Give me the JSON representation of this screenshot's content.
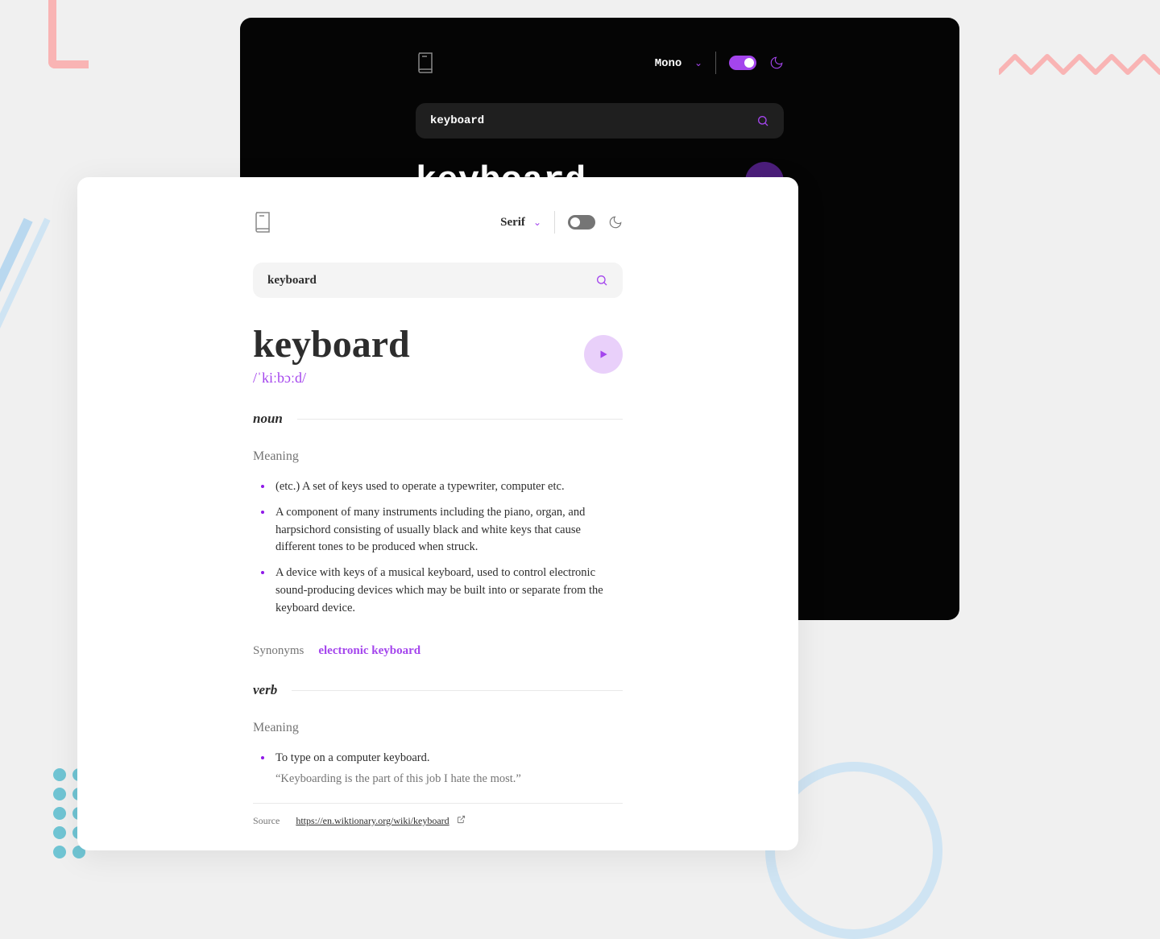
{
  "dark": {
    "font_label": "Mono",
    "search_value": "keyboard",
    "word": "keyboard"
  },
  "light": {
    "font_label": "Serif",
    "search_value": "keyboard",
    "word": "keyboard",
    "phonetic": "/ˈkiːbɔːd/",
    "noun": {
      "pos": "noun",
      "meaning_label": "Meaning",
      "defs": [
        "(etc.) A set of keys used to operate a typewriter, computer etc.",
        "A component of many instruments including the piano, organ, and harpsichord consisting of usually black and white keys that cause different tones to be produced when struck.",
        "A device with keys of a musical keyboard, used to control electronic sound-producing devices which may be built into or separate from the keyboard device."
      ],
      "synonyms_label": "Synonyms",
      "synonyms": "electronic keyboard"
    },
    "verb": {
      "pos": "verb",
      "meaning_label": "Meaning",
      "def": "To type on a computer keyboard.",
      "example": "“Keyboarding is the part of this job I hate the most.”"
    },
    "source_label": "Source",
    "source_url": "https://en.wiktionary.org/wiki/keyboard"
  }
}
